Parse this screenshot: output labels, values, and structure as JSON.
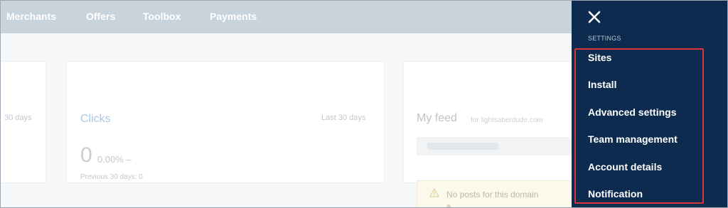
{
  "nav": {
    "items": [
      "Merchants",
      "Offers",
      "Toolbox",
      "Payments"
    ]
  },
  "dashboard": {
    "left_card": {
      "period": "30 days"
    },
    "clicks_card": {
      "title": "Clicks",
      "period": "Last 30 days",
      "value": "0",
      "change": "0.00% –",
      "previous": "Previous 30 days: 0"
    },
    "feed_card": {
      "title": "My feed",
      "domain": "for lightsaberdude.com",
      "alert_text": "No posts for this domain"
    }
  },
  "settings_panel": {
    "heading": "SETTINGS",
    "items": [
      "Sites",
      "Install",
      "Advanced settings",
      "Team management",
      "Account details",
      "Notification"
    ],
    "highlight_color": "#d9363e",
    "background_color": "#0d2b4e"
  }
}
